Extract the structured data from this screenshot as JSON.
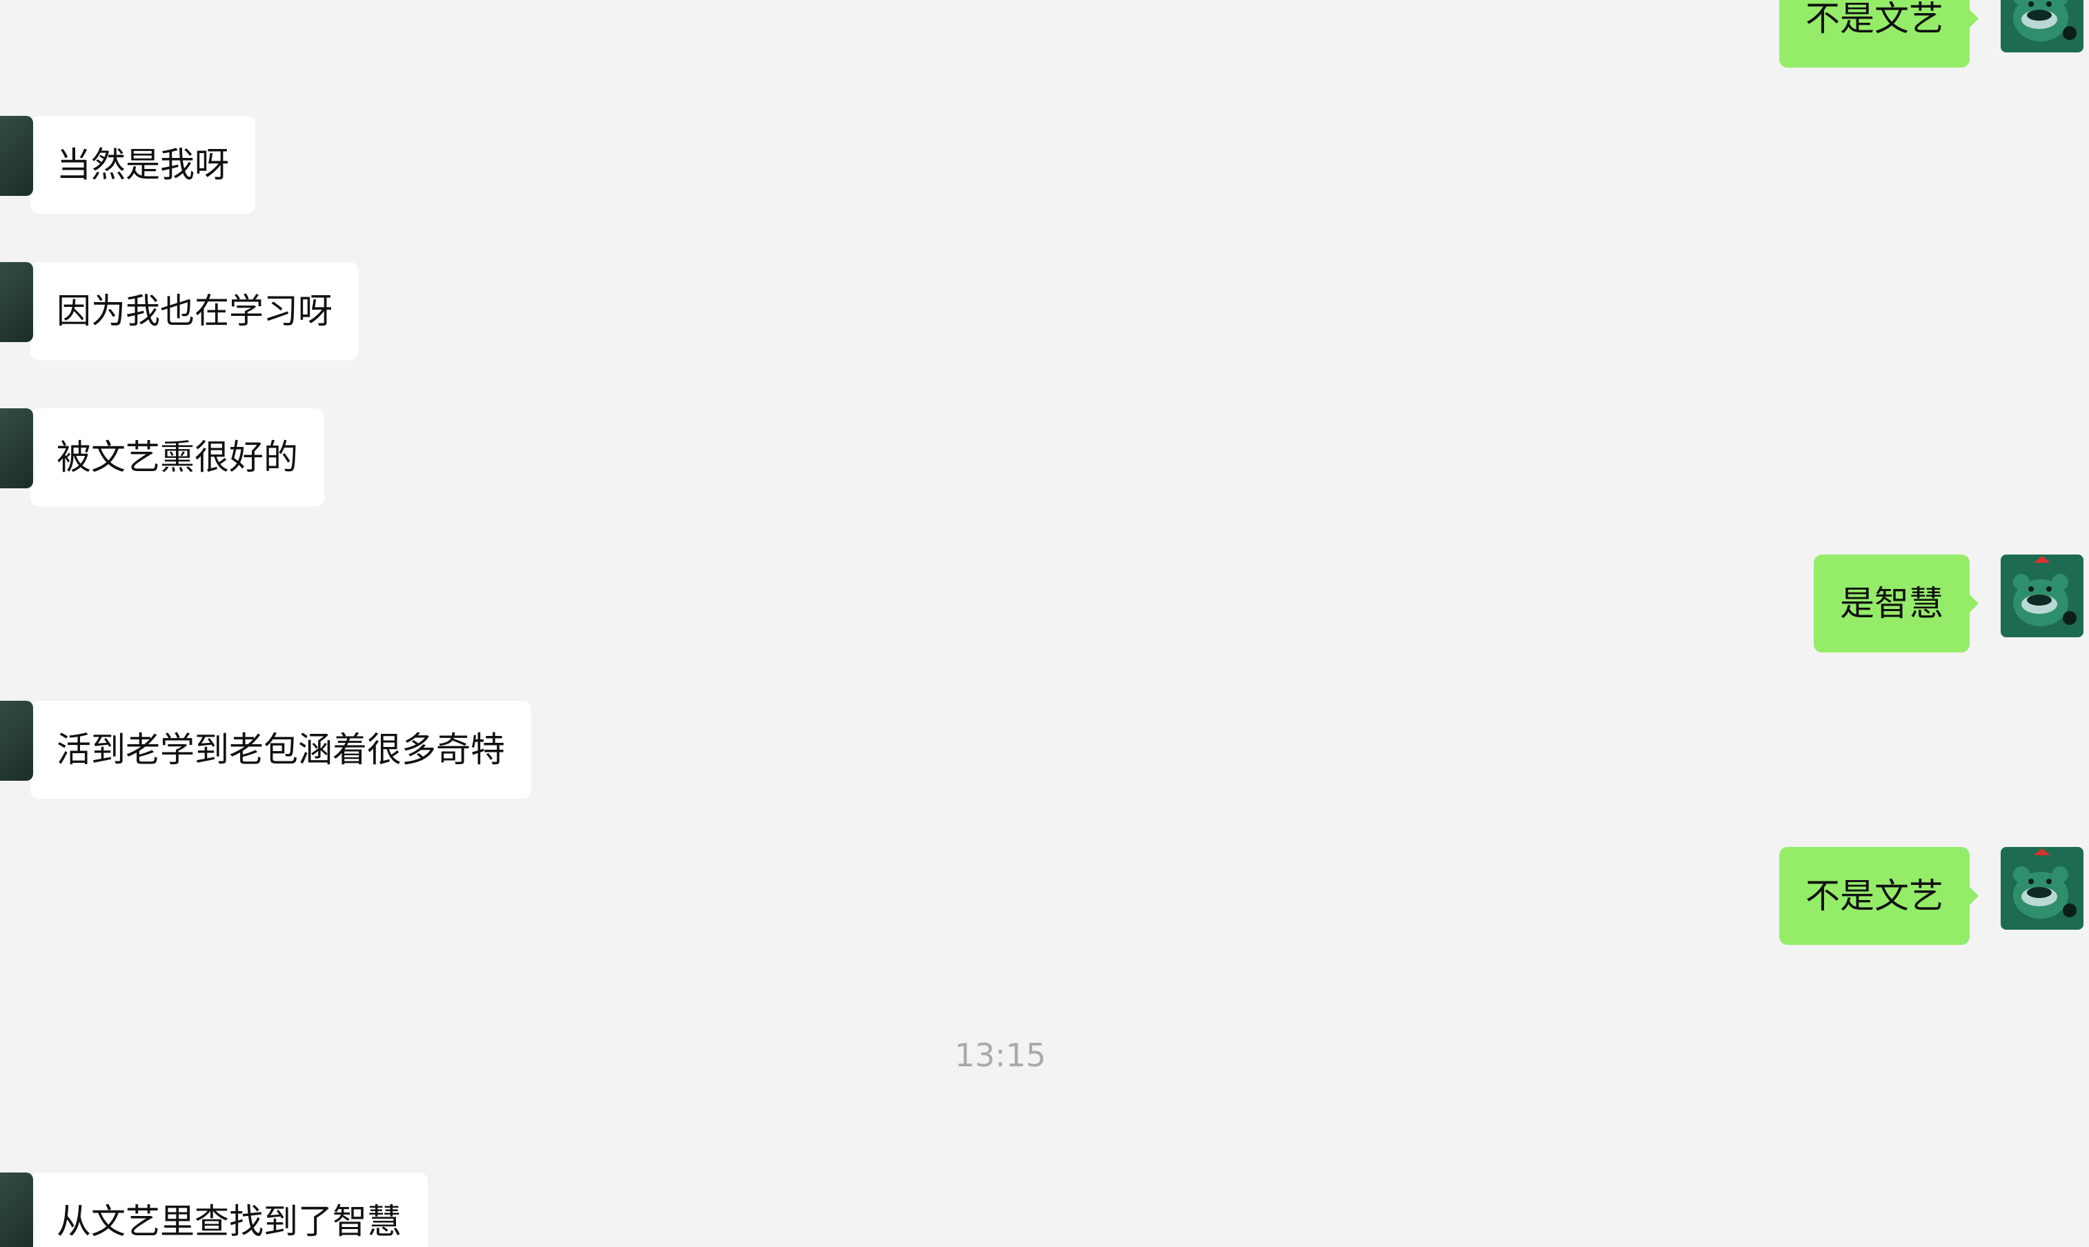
{
  "messages": [
    {
      "direction": "outgoing",
      "text": "不是文艺"
    },
    {
      "direction": "incoming",
      "text": "当然是我呀"
    },
    {
      "direction": "incoming",
      "text": "因为我也在学习呀"
    },
    {
      "direction": "incoming",
      "text": "被文艺熏很好的"
    },
    {
      "direction": "outgoing",
      "text": "是智慧"
    },
    {
      "direction": "incoming",
      "text": "活到老学到老包涵着很多奇特"
    },
    {
      "direction": "outgoing",
      "text": "不是文艺"
    },
    {
      "direction": "incoming",
      "text": "从文艺里查找到了智慧"
    }
  ],
  "timestamp": "13:15",
  "colors": {
    "background": "#f3f3f3",
    "incoming_bubble": "#ffffff",
    "outgoing_bubble": "#95ec69",
    "timestamp_text": "#a9a9a9"
  },
  "icons": {
    "own_avatar": "green-creature-avatar-icon",
    "contact_avatar": "contact-avatar-icon"
  }
}
